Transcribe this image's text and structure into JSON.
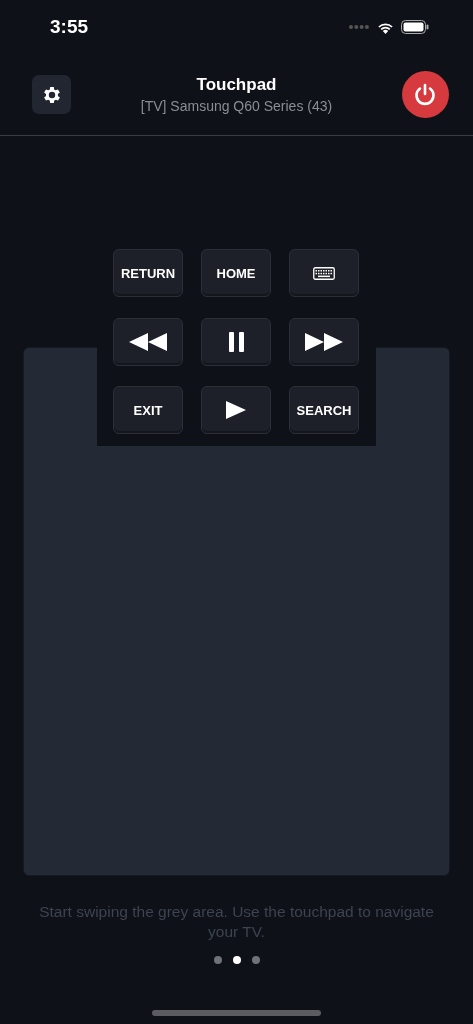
{
  "status_bar": {
    "time": "3:55"
  },
  "header": {
    "title": "Touchpad",
    "subtitle": "[TV] Samsung Q60 Series (43)"
  },
  "buttons": [
    {
      "kind": "text",
      "label": "RETURN"
    },
    {
      "kind": "text",
      "label": "HOME"
    },
    {
      "kind": "keyboard"
    },
    {
      "kind": "rewind"
    },
    {
      "kind": "pause"
    },
    {
      "kind": "forward"
    },
    {
      "kind": "text",
      "label": "EXIT"
    },
    {
      "kind": "play"
    },
    {
      "kind": "text",
      "label": "SEARCH"
    }
  ],
  "hint": "Start swiping the grey area. Use the touchpad to navigate your TV.",
  "pages": [
    {
      "selected": false
    },
    {
      "selected": true
    },
    {
      "selected": false
    }
  ]
}
